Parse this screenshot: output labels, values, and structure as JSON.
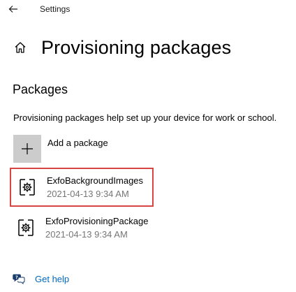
{
  "titlebar": {
    "back_icon": "back-arrow-icon",
    "title": "Settings"
  },
  "header": {
    "home_icon": "home-icon",
    "title": "Provisioning packages"
  },
  "packages_section": {
    "heading": "Packages",
    "description": "Provisioning packages help set up your device for work or school.",
    "add_package": {
      "icon": "plus-icon",
      "label": "Add a package"
    },
    "items": [
      {
        "name": "ExfoBackgroundImages",
        "date": "2021-04-13 9:34 AM",
        "icon": "provisioning-package-icon",
        "selected": true
      },
      {
        "name": "ExfoProvisioningPackage",
        "date": "2021-04-13 9:34 AM",
        "icon": "provisioning-package-icon",
        "selected": false
      }
    ]
  },
  "help": {
    "icon": "get-help-icon",
    "label": "Get help"
  },
  "colors": {
    "link": "#0067c0",
    "selection_border": "#d64541",
    "add_tile_bg": "#cccccc",
    "secondary_text": "#767676"
  }
}
